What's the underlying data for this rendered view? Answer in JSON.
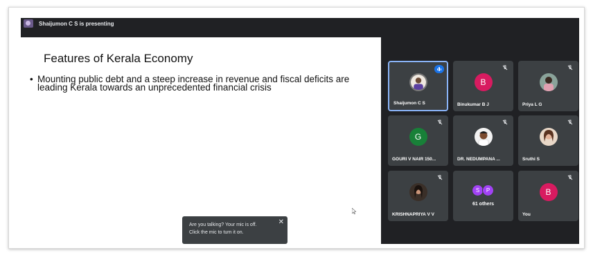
{
  "banner": {
    "presenter_text": "Shaijumon C S is presenting"
  },
  "slide": {
    "title": "Features of Kerala Economy",
    "bullet": "Mounting public debt and a steep increase in revenue and fiscal deficits are leading Kerala towards an unprecedented financial crisis"
  },
  "toast": {
    "line1": "Are you talking? Your mic is off.",
    "line2": "Click the mic to turn it on.",
    "close": "✕"
  },
  "participants": [
    {
      "name": "Shaijumon C S",
      "avatar": "photo",
      "state": "speaking"
    },
    {
      "name": "Binukumar B J",
      "initial": "B",
      "color": "#d81b60",
      "state": "muted"
    },
    {
      "name": "Priya L G",
      "avatar": "photo",
      "state": "muted"
    },
    {
      "name": "GOURI V NAIR 150...",
      "initial": "G",
      "color": "#188038",
      "state": "muted"
    },
    {
      "name": "DR. NEDUMPANA ...",
      "avatar": "photo",
      "state": "muted"
    },
    {
      "name": "Sruthi S",
      "avatar": "photo",
      "state": "muted"
    },
    {
      "name": "KRISHNAPRIYA V V",
      "avatar": "photo",
      "state": "muted"
    },
    {
      "name": "61 others",
      "initials": [
        "S",
        "P"
      ],
      "color": "#a142f4"
    },
    {
      "name": "You",
      "initial": "B",
      "color": "#d81b60",
      "state": "muted"
    }
  ],
  "colors": {
    "meet_bg": "#202124",
    "tile_bg": "#3c4043",
    "active_border": "#8ab4f8",
    "speaking": "#1a73e8"
  }
}
